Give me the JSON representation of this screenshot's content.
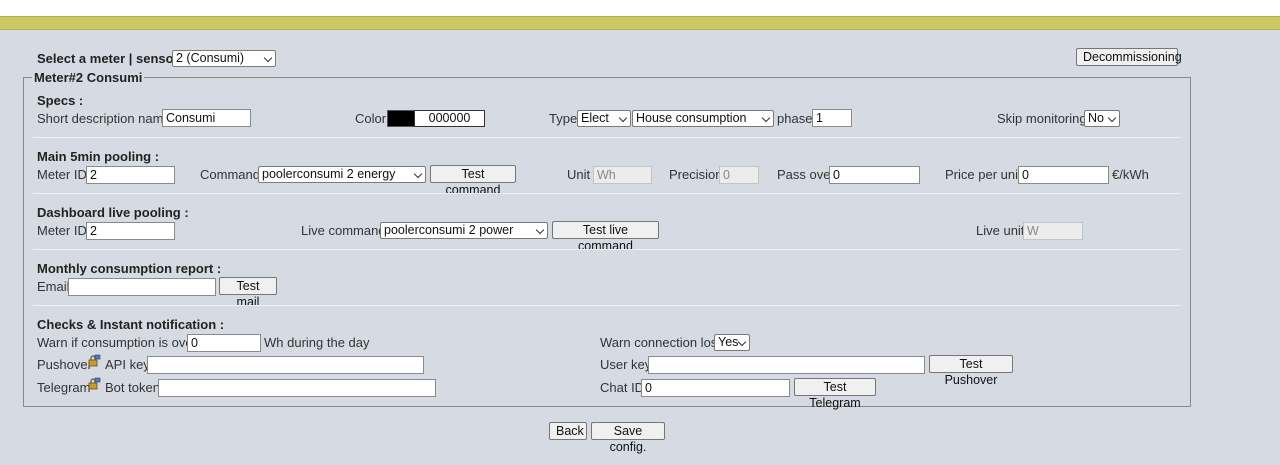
{
  "meter_select": {
    "label": "Select a meter | sensor :",
    "value": "2 (Consumi)"
  },
  "decommissioning_label": "Decommissioning",
  "legend": "Meter#2 Consumi",
  "specs": {
    "title": "Specs :",
    "short_desc_label": "Short description name",
    "short_desc_value": "Consumi",
    "color_label": "Color",
    "color_value": "000000",
    "type_label": "Type",
    "type_value": "Elect",
    "subtype_value": "House consumption",
    "phase_label": "phase",
    "phase_value": "1",
    "skip_label": "Skip monitoring",
    "skip_value": "No"
  },
  "main": {
    "title": "Main 5min pooling :",
    "meter_id_label": "Meter ID",
    "meter_id_value": "2",
    "command_label": "Command",
    "command_value": "poolerconsumi 2 energy",
    "test_command_label": "Test command",
    "unit_label": "Unit",
    "unit_value": "Wh",
    "precision_label": "Precision",
    "precision_value": "0",
    "pass_over_label": "Pass over",
    "pass_over_value": "0",
    "price_label": "Price per unit",
    "price_value": "0",
    "price_unit": "€/kWh"
  },
  "live": {
    "title": "Dashboard live pooling :",
    "meter_id_label": "Meter ID",
    "meter_id_value": "2",
    "live_command_label": "Live command",
    "live_command_value": "poolerconsumi 2 power",
    "test_live_label": "Test live command",
    "live_unit_label": "Live unit",
    "live_unit_value": "W"
  },
  "report": {
    "title": "Monthly consumption report :",
    "email_label": "Email",
    "email_value": "",
    "test_mail_label": "Test mail"
  },
  "checks": {
    "title": "Checks & Instant notification :",
    "warn_over_label": "Warn if consumption is over",
    "warn_over_value": "0",
    "warn_over_suffix": "Wh during the day",
    "warn_lost_label": "Warn connection lost",
    "warn_lost_value": "Yes",
    "pushover_label": "Pushover",
    "api_key_label": "API key",
    "api_key_value": "",
    "user_key_label": "User key",
    "user_key_value": "",
    "test_pushover_label": "Test Pushover",
    "telegram_label": "Telegram",
    "bot_token_label": "Bot token",
    "bot_token_value": "",
    "chat_id_label": "Chat ID",
    "chat_id_value": "0",
    "test_telegram_label": "Test Telegram"
  },
  "footer": {
    "back_label": "Back",
    "save_label": "Save config."
  },
  "colors": {
    "top_bar": "#c9c862",
    "background": "#d6dbe3",
    "swatch": "#000000"
  }
}
